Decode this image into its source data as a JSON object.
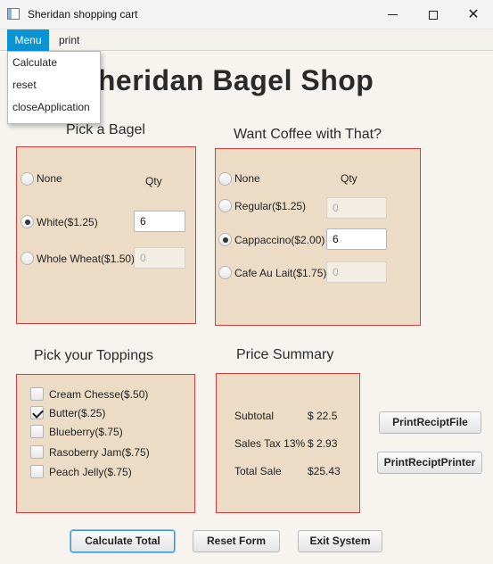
{
  "window": {
    "title": "Sheridan shopping cart",
    "minimize_glyph": "",
    "close_glyph": "✕"
  },
  "menubar": {
    "items": [
      {
        "label": "Menu"
      },
      {
        "label": "print"
      }
    ],
    "dropdown": [
      "Calculate",
      "reset",
      "closeApplication"
    ]
  },
  "shop_title": "Sheridan Bagel Shop",
  "bagel": {
    "title": "Pick a Bagel",
    "qty_label": "Qty",
    "options": [
      {
        "label": "None",
        "checked": false
      },
      {
        "label": "White($1.25)",
        "checked": true,
        "qty": "6"
      },
      {
        "label": "Whole Wheat($1.50)",
        "checked": false,
        "qty": "0"
      }
    ]
  },
  "coffee": {
    "title": "Want Coffee with That?",
    "qty_label": "Qty",
    "options": [
      {
        "label": "None",
        "checked": false
      },
      {
        "label": "Regular($1.25)",
        "checked": false,
        "qty": "0"
      },
      {
        "label": "Cappaccino($2.00)",
        "checked": true,
        "qty": "6"
      },
      {
        "label": "Cafe Au Lait($1.75)",
        "checked": false,
        "qty": "0"
      }
    ]
  },
  "toppings": {
    "title": "Pick your Toppings",
    "items": [
      {
        "label": "Cream Chesse($.50)",
        "checked": false
      },
      {
        "label": "Butter($.25)",
        "checked": true
      },
      {
        "label": "Blueberry($.75)",
        "checked": false
      },
      {
        "label": "Rasoberry Jam($.75)",
        "checked": false
      },
      {
        "label": "Peach Jelly($.75)",
        "checked": false
      }
    ]
  },
  "summary": {
    "title": "Price Summary",
    "rows": [
      {
        "label": "Subtotal",
        "value": "$ 22.5"
      },
      {
        "label": "Sales Tax 13%",
        "value": "$ 2.93"
      },
      {
        "label": "Total Sale",
        "value": "$25.43"
      }
    ]
  },
  "print_buttons": {
    "file": "PrintReciptFile",
    "printer": "PrintReciptPrinter"
  },
  "actions": {
    "calculate": "Calculate Total",
    "reset": "Reset Form",
    "exit": "Exit System"
  },
  "colors": {
    "menu_accent": "#0b93d3",
    "panel_bg": "#ecdcc6",
    "panel_border": "#d63d3d"
  }
}
